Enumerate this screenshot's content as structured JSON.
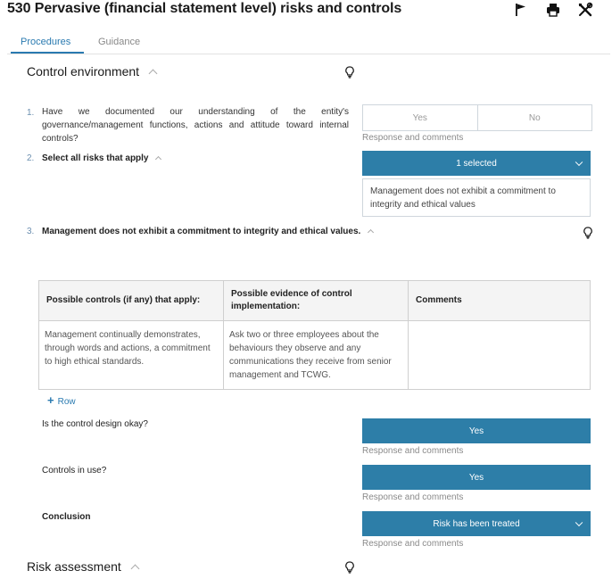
{
  "header": {
    "title": "530 Pervasive (financial statement level) risks and controls"
  },
  "tabs": [
    {
      "label": "Procedures"
    },
    {
      "label": "Guidance"
    }
  ],
  "control_environment": {
    "title": "Control environment",
    "questions": [
      {
        "number": "1.",
        "text": "Have we documented our understanding of the entity's governance/management functions, actions and attitude toward internal controls?",
        "options": [
          "Yes",
          "No"
        ],
        "response_label": "Response and comments"
      },
      {
        "number": "2.",
        "text": "Select all risks that apply",
        "dropdown_value": "1 selected",
        "selected_item": "Management does not exhibit a commitment to integrity and ethical values"
      },
      {
        "number": "3.",
        "text": "Management does not exhibit a commitment to integrity and ethical values."
      }
    ],
    "table": {
      "headers": [
        "Possible controls (if any) that apply:",
        "Possible evidence of control implementation:",
        "Comments"
      ],
      "rows": [
        [
          "Management continually demonstrates, through words and actions, a commitment to high ethical standards.",
          "Ask two or three employees about the behaviours they observe and any communications they receive from senior management and TCWG.",
          ""
        ]
      ],
      "add_row_label": "Row"
    },
    "control_design": {
      "label": "Is the control design okay?",
      "value": "Yes",
      "response_label": "Response and comments"
    },
    "controls_in_use": {
      "label": "Controls in use?",
      "value": "Yes",
      "response_label": "Response and comments"
    },
    "conclusion": {
      "label": "Conclusion",
      "value": "Risk has been treated",
      "response_label": "Response and comments"
    }
  },
  "risk_assessment": {
    "title": "Risk assessment"
  }
}
